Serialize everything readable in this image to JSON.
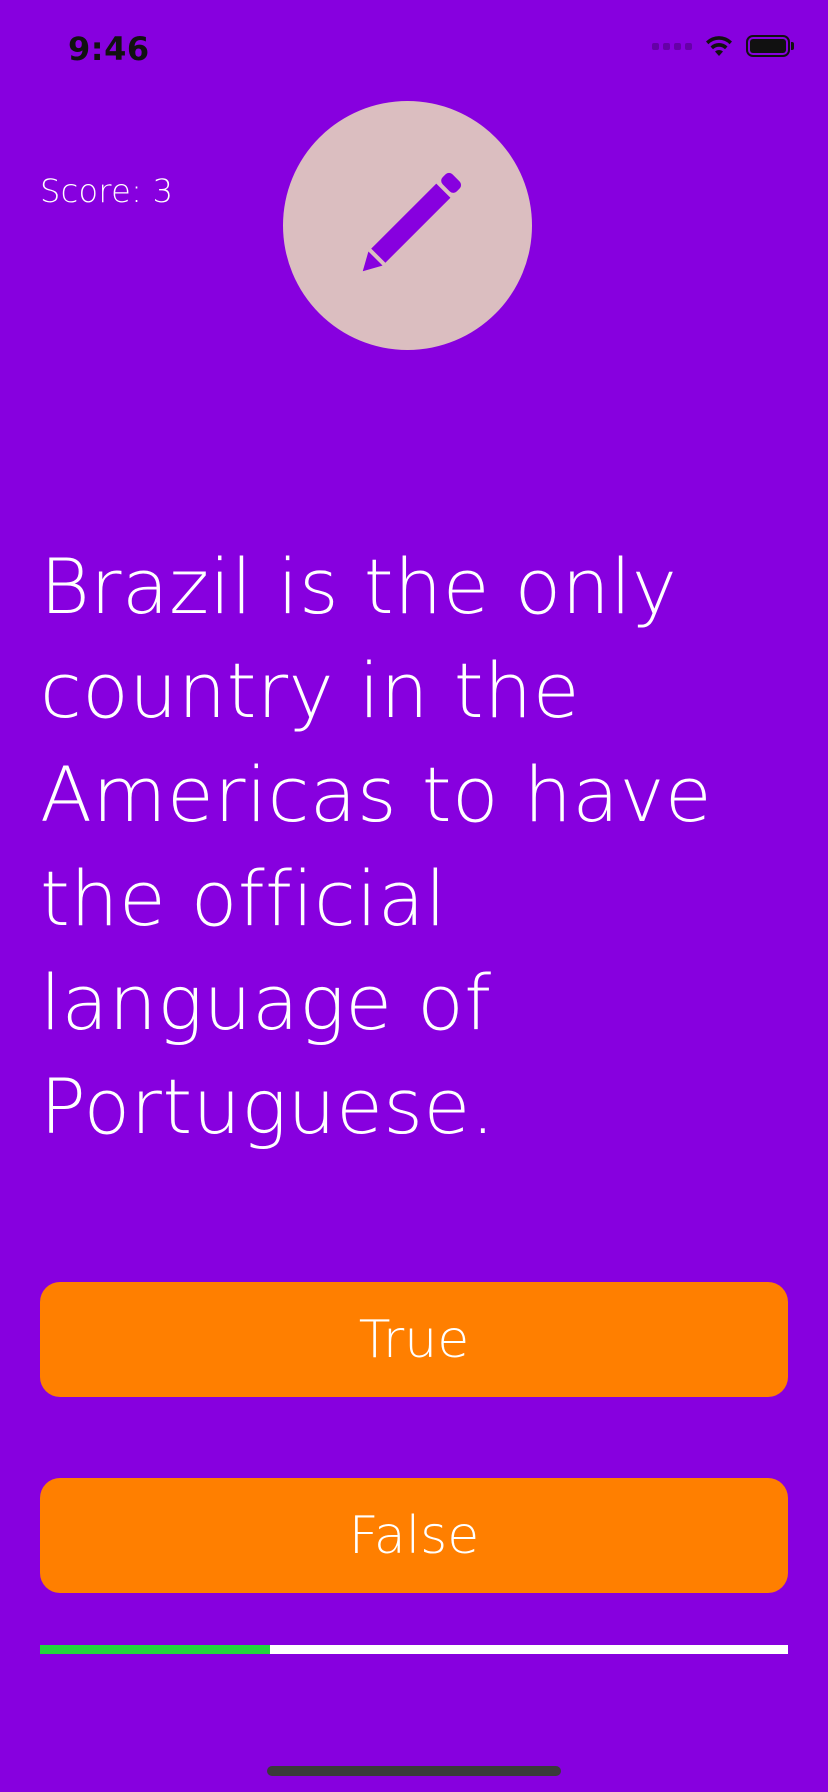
{
  "status_bar": {
    "time": "9:46"
  },
  "score": {
    "label": "Score: 3",
    "value": 3
  },
  "badge": {
    "icon": "pencil-icon",
    "background_color": "#DBBEC0"
  },
  "question": {
    "text": "Brazil is the only country in the Americas to have the official language of Portuguese."
  },
  "answers": {
    "true_label": "True",
    "false_label": "False"
  },
  "progress": {
    "fraction": 0.307
  },
  "colors": {
    "background": "#8700DF",
    "button": "#FF7F00",
    "progress_fill": "#22D63C",
    "progress_track": "#FFFFFF"
  }
}
